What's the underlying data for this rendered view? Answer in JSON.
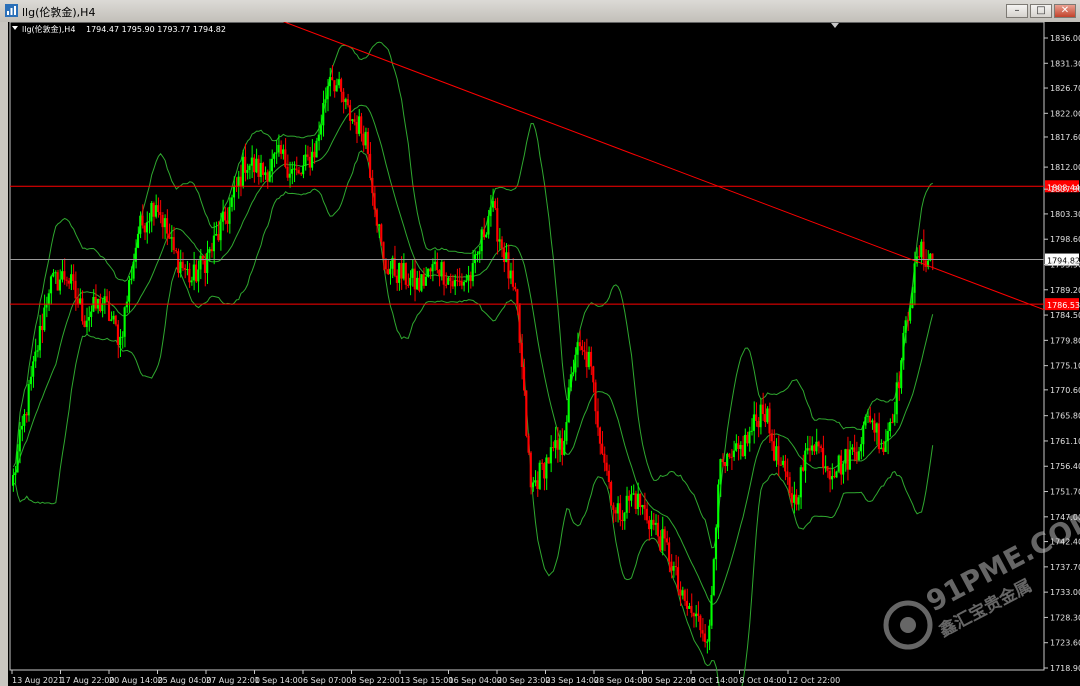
{
  "window": {
    "title": "llg(伦敦金),H4",
    "buttons": {
      "minimize": "–",
      "maximize": "□",
      "close": "✕"
    }
  },
  "info_line": {
    "symbol": "llg(伦敦金),H4",
    "ohlc": "1794.47 1795.90 1793.77 1794.82"
  },
  "watermark": {
    "text": "91PME.COM",
    "subtext": "鑫汇宝贵金属"
  },
  "colors": {
    "up": "#00ff00",
    "down": "#ff0000",
    "bands": "#2fa82f",
    "grid": "#000000",
    "lines": "#ff0000",
    "price_line": "#9a9a9a"
  },
  "chart_data": {
    "type": "candlestick",
    "ylim": [
      1718.9,
      1838.6
    ],
    "yticks": [
      "1836.00",
      "1831.30",
      "1826.70",
      "1822.00",
      "1817.60",
      "1812.00",
      "1807.90",
      "1803.30",
      "1798.60",
      "1793.90",
      "1789.20",
      "1784.50",
      "1779.80",
      "1775.10",
      "1770.60",
      "1765.80",
      "1761.10",
      "1756.40",
      "1751.70",
      "1747.00",
      "1742.40",
      "1737.70",
      "1733.00",
      "1728.30",
      "1723.60",
      "1718.90"
    ],
    "xticks": [
      "13 Aug 2021",
      "17 Aug 22:00",
      "20 Aug 14:00",
      "25 Aug 04:00",
      "27 Aug 22:00",
      "1 Sep 14:00",
      "6 Sep 07:00",
      "8 Sep 22:00",
      "13 Sep 15:00",
      "16 Sep 04:00",
      "20 Sep 23:00",
      "23 Sep 14:00",
      "28 Sep 04:00",
      "30 Sep 22:00",
      "5 Oct 14:00",
      "8 Oct 04:00",
      "12 Oct 22:00"
    ],
    "current_price": {
      "label": "1794.82",
      "value": 1794.82
    },
    "horizontal_lines": [
      {
        "label": "1808.44",
        "value": 1808.44
      },
      {
        "label": "1786.53",
        "value": 1786.53
      }
    ],
    "trendline": {
      "from": {
        "bar": 0,
        "price": 1844.0
      },
      "to": {
        "bar": 1,
        "price": 1785.5
      }
    },
    "waypoints": [
      [
        0,
        1754
      ],
      [
        8,
        1772
      ],
      [
        16,
        1790
      ],
      [
        24,
        1792
      ],
      [
        32,
        1784
      ],
      [
        40,
        1787
      ],
      [
        48,
        1780
      ],
      [
        56,
        1800
      ],
      [
        64,
        1806
      ],
      [
        72,
        1796
      ],
      [
        80,
        1791
      ],
      [
        88,
        1796
      ],
      [
        96,
        1803
      ],
      [
        104,
        1813
      ],
      [
        112,
        1811
      ],
      [
        120,
        1814
      ],
      [
        128,
        1810
      ],
      [
        136,
        1816
      ],
      [
        142,
        1830
      ],
      [
        150,
        1822
      ],
      [
        158,
        1818
      ],
      [
        166,
        1794
      ],
      [
        174,
        1792
      ],
      [
        182,
        1790
      ],
      [
        190,
        1794
      ],
      [
        198,
        1790
      ],
      [
        206,
        1792
      ],
      [
        214,
        1805
      ],
      [
        220,
        1796
      ],
      [
        226,
        1785
      ],
      [
        232,
        1752
      ],
      [
        240,
        1758
      ],
      [
        246,
        1760
      ],
      [
        252,
        1778
      ],
      [
        258,
        1776
      ],
      [
        264,
        1760
      ],
      [
        270,
        1747
      ],
      [
        278,
        1751
      ],
      [
        286,
        1746
      ],
      [
        294,
        1740
      ],
      [
        300,
        1731
      ],
      [
        306,
        1728
      ],
      [
        312,
        1725
      ],
      [
        316,
        1755
      ],
      [
        322,
        1757
      ],
      [
        330,
        1762
      ],
      [
        336,
        1768
      ],
      [
        342,
        1758
      ],
      [
        350,
        1750
      ],
      [
        358,
        1762
      ],
      [
        366,
        1756
      ],
      [
        372,
        1757
      ],
      [
        378,
        1760
      ],
      [
        384,
        1766
      ],
      [
        390,
        1760
      ],
      [
        396,
        1770
      ],
      [
        402,
        1788
      ],
      [
        406,
        1796
      ],
      [
        412,
        1795
      ]
    ]
  }
}
